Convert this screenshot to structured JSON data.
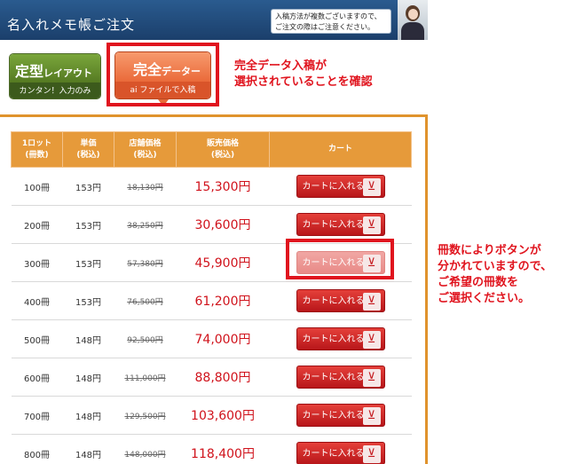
{
  "header": {
    "title": "名入れメモ帳ご注文",
    "note": "入稿方法が複数ございますので、ご注文の際はご注意ください。"
  },
  "options": {
    "teikei": {
      "title": "定型",
      "title_small": "レイアウト",
      "sub": "カンタン！入力のみ"
    },
    "kanzen": {
      "title": "完全",
      "title_small": "データー",
      "sub": "ai ファイルで入稿"
    }
  },
  "annotations": {
    "top_line1": "完全データ入稿が",
    "top_line2": "選択されていることを確認",
    "side_line1": "冊数によりボタンが",
    "side_line2": "分かれていますので、",
    "side_line3": "ご希望の冊数を",
    "side_line4": "ご選択ください。"
  },
  "table": {
    "headers": [
      "1ロット\n(冊数)",
      "単価\n(税込)",
      "店舗価格\n(税込)",
      "販売価格\n(税込)",
      "カート"
    ],
    "cart_label": "カートに入れる",
    "rows": [
      {
        "lot": "100冊",
        "unit": "153円",
        "store": "18,130円",
        "sale": "15,300円",
        "disabled": false
      },
      {
        "lot": "200冊",
        "unit": "153円",
        "store": "38,250円",
        "sale": "30,600円",
        "disabled": false
      },
      {
        "lot": "300冊",
        "unit": "153円",
        "store": "57,380円",
        "sale": "45,900円",
        "disabled": true
      },
      {
        "lot": "400冊",
        "unit": "153円",
        "store": "76,500円",
        "sale": "61,200円",
        "disabled": false
      },
      {
        "lot": "500冊",
        "unit": "148円",
        "store": "92,500円",
        "sale": "74,000円",
        "disabled": false
      },
      {
        "lot": "600冊",
        "unit": "148円",
        "store": "111,000円",
        "sale": "88,800円",
        "disabled": false
      },
      {
        "lot": "700冊",
        "unit": "148円",
        "store": "129,500円",
        "sale": "103,600円",
        "disabled": false
      },
      {
        "lot": "800冊",
        "unit": "148円",
        "store": "148,000円",
        "sale": "118,400円",
        "disabled": false
      }
    ]
  },
  "colors": {
    "header_blue": "#1b3f6b",
    "accent_red": "#e0141e",
    "table_orange": "#e69a3a",
    "sale_red": "#d0121b"
  }
}
